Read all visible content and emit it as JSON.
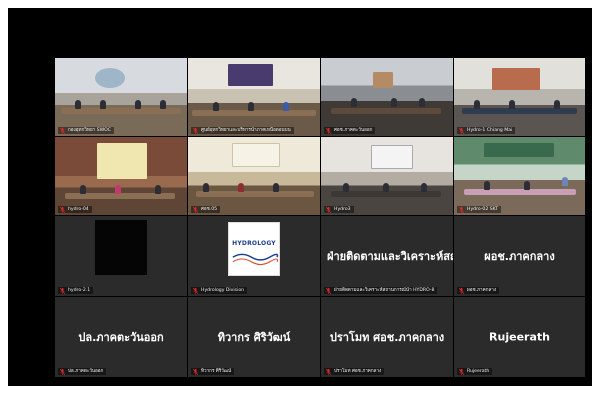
{
  "tiles": [
    {
      "label": "กองอุทกวิทยา SWOC"
    },
    {
      "label": "ศูนย์อุทกวิทยาและบริหารน้ำภาคเหนือตอนบน"
    },
    {
      "label": "ศอช.ภาคตะวันออก"
    },
    {
      "label": "Hydro-1 Chiang Mai"
    },
    {
      "label": "hydro-04"
    },
    {
      "label": "ศอช.05"
    },
    {
      "label": "Hydro3"
    },
    {
      "label": "Hydro-02 SKT"
    },
    {
      "label": "hydro-2.1"
    },
    {
      "label": "Hydrology Division",
      "logo_text": "HYDROLOGY"
    },
    {
      "name": "ฝ่ายติดตามและวิเคราะห์สถาน...",
      "label": "ฝ่ายติดตามและวิเคราะห์สถานการณ์น้ำ HYDRO-8"
    },
    {
      "name": "ผอช.ภาคกลาง",
      "label": "ผอช.ภาคกลาง"
    },
    {
      "name": "ปล.ภาคตะวันออก",
      "label": "ปล.ภาคตะวันออก"
    },
    {
      "name": "ทิวากร ศิริวัฒน์",
      "label": "ทิวากร ศิริวัฒน์"
    },
    {
      "name": "ปราโมท ศอช.ภาคกลาง",
      "label": "ปราโมท ศอช.ภาคกลาง"
    },
    {
      "name": "Rujeerath",
      "label": "Rujeerath"
    }
  ],
  "icons": {
    "mic_muted": "mic-muted-icon"
  },
  "colors": {
    "mic_muted": "#e02a2a",
    "background": "#000000",
    "tile": "#2b2b2b"
  }
}
